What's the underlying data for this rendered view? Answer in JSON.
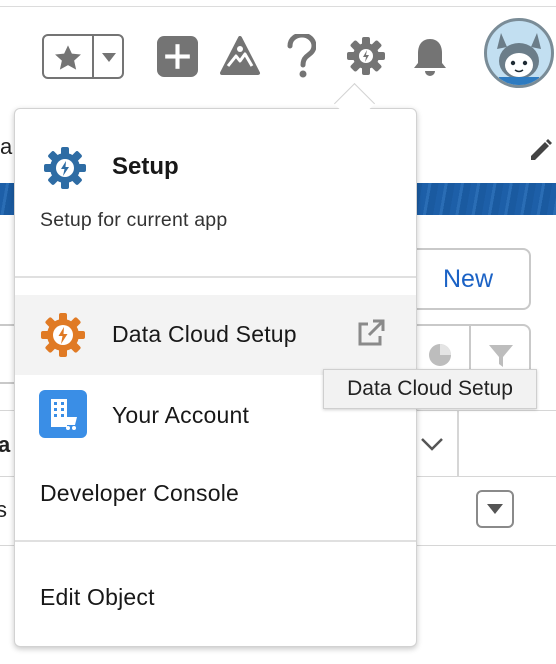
{
  "header": {
    "favorites_icon": "star-icon",
    "favorites_menu_icon": "chevron-down-icon",
    "global_actions_icon": "plus-icon",
    "trailhead_icon": "trailhead-icon",
    "help_icon": "question-icon",
    "setup_icon": "gear-icon",
    "notifications_icon": "bell-icon",
    "avatar": "user-avatar"
  },
  "page": {
    "new_button_label": "New",
    "left_partial_text": "a",
    "col_partial_text": "a",
    "row_partial_text": "s"
  },
  "setup_menu": {
    "title": "Setup",
    "subtitle": "Setup for current app",
    "items": [
      {
        "label": "Data Cloud Setup",
        "icon": "gear-icon",
        "trailing_icon": "external-link-icon"
      },
      {
        "label": "Your Account",
        "icon": "account-store-icon"
      },
      {
        "label": "Developer Console"
      },
      {
        "label": "Edit Object"
      }
    ]
  },
  "tooltip": {
    "text": "Data Cloud Setup"
  },
  "colors": {
    "brand_blue": "#1b62c5",
    "setup_gear": "#2e6ca4",
    "data_cloud_gear": "#e07a24",
    "account_icon_bg": "#3a8ee6"
  }
}
